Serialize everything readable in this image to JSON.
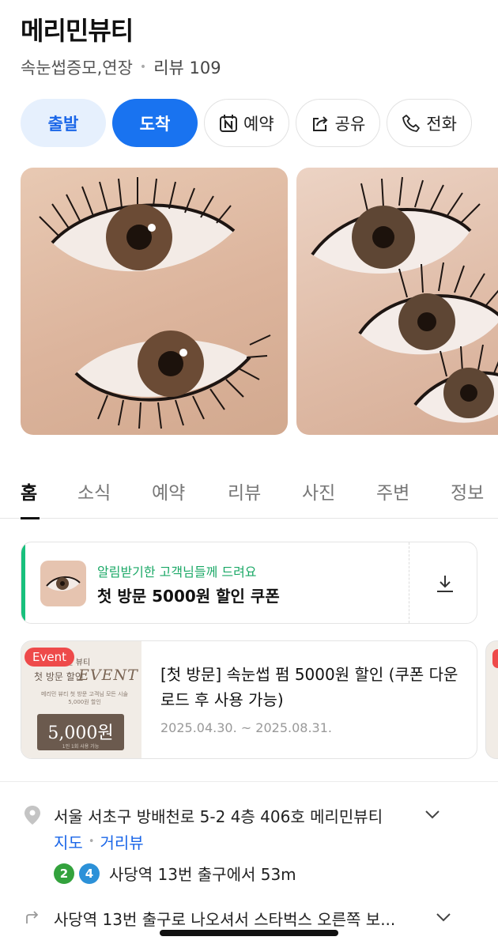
{
  "place": {
    "name": "메리민뷰티",
    "category": "속눈썹증모,연장",
    "review_label": "리뷰 109"
  },
  "actions": {
    "depart": "출발",
    "arrive": "도착",
    "reserve": "예약",
    "share": "공유",
    "call": "전화"
  },
  "tabs": [
    "홈",
    "소식",
    "예약",
    "리뷰",
    "사진",
    "주변",
    "정보"
  ],
  "coupon": {
    "notice": "알림받기한 고객님들께 드려요",
    "title": "첫 방문 5000원 할인 쿠폰"
  },
  "event": {
    "badge": "Event",
    "image_brand": "메리민 뷰티",
    "image_title": "첫 방문 할인",
    "image_word": "EVENT",
    "image_desc": "메리민 뷰티 첫 방문 고객님 모든 시술 5,000원 할인",
    "image_price": "5,000원",
    "image_price_sub": "1인 1회 사용 가능",
    "text": "[첫 방문] 속눈썹 펌 5000원 할인 (쿠폰 다운로드 후 사용 가능)",
    "period": "2025.04.30. ~ 2025.08.31."
  },
  "location": {
    "address": "서울 서초구 방배천로 5-2 4층 406호 메리민뷰티",
    "map_link": "지도",
    "street_view_link": "거리뷰",
    "line_badges": [
      "2",
      "4"
    ],
    "station_text": "사당역 13번 출구에서 53m",
    "directions": "사당역 13번 출구로 나오셔서 스타벅스 오른쪽 보..."
  },
  "colors": {
    "primary": "#1973f0",
    "depart_bg": "#e6f0fd",
    "coupon_green": "#17c07c",
    "event_red": "#ee4a4a",
    "line2": "#33a23d",
    "line4": "#2c91d8"
  }
}
